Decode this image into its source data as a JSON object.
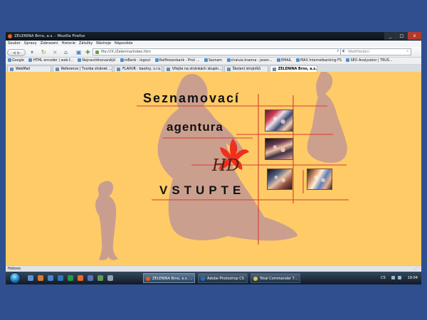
{
  "window": {
    "title": "ZELENINA Brno, a.s. - Mozilla Firefox",
    "controls": [
      "_",
      "□",
      "x"
    ]
  },
  "menu": [
    "Soubor",
    "Úpravy",
    "Zobrazení",
    "Historie",
    "Záložky",
    "Nástroje",
    "Nápověda"
  ],
  "navigation": {
    "address": "file:///X:/Zelenina/index.htm",
    "search_placeholder": "WebHledání"
  },
  "bookmarks": [
    "Google",
    "HTML encoder | web.f...",
    "Nejnavštěvovanější",
    "mBank - logout",
    "Raiffeisenbank - Proč ...",
    "Seznam",
    "chaluia branna - jesen...",
    "EMAIL",
    "MAX Internetbanking FS",
    "SEO Analyzator | TRUS..."
  ],
  "tabs": [
    "WebMail",
    "Reference | Tvorba stránek ...",
    "FLAVUR - baotny, s.r.o.",
    "Vítejte na stránkách skupin...",
    "Školení strojníků",
    "ZELENINA Brno, a.s."
  ],
  "page": {
    "headline_1": "Seznamovací",
    "headline_2": "agentura",
    "logo_text": "HD",
    "call_to_action": "VSTUPTE"
  },
  "status": "Hotovo",
  "taskbar": {
    "tasks": [
      "ZELENINA Brno, a.s. ...",
      "Adobe Photoshop CS",
      "Total Commander 7..."
    ],
    "language": "CS",
    "time": "19:04"
  },
  "colors": {
    "page_background": "#fecb67",
    "grid_lines": "#d73b36",
    "silhouette": "#c79b91"
  }
}
